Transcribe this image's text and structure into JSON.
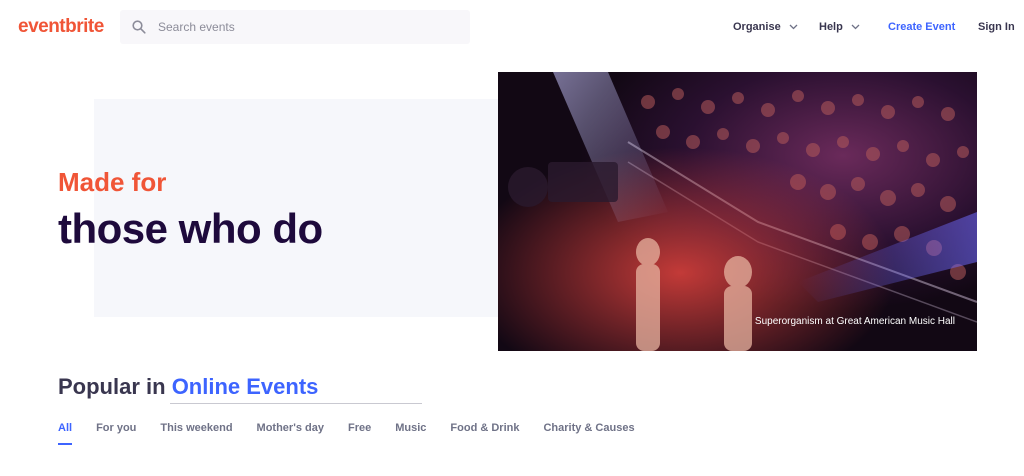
{
  "header": {
    "logo": "eventbrite",
    "search_placeholder": "Search events",
    "nav": {
      "organise": "Organise",
      "help": "Help",
      "create_event": "Create Event",
      "sign_in": "Sign In"
    }
  },
  "hero": {
    "line1": "Made for",
    "line2": "those who do",
    "caption": "Superorganism at Great American Music Hall"
  },
  "popular": {
    "prefix": "Popular in",
    "location": "Online Events",
    "tabs": [
      "All",
      "For you",
      "This weekend",
      "Mother's day",
      "Free",
      "Music",
      "Food & Drink",
      "Charity & Causes"
    ]
  },
  "colors": {
    "brand": "#f05537",
    "accent": "#3d64ff",
    "text": "#1e0a3c"
  }
}
